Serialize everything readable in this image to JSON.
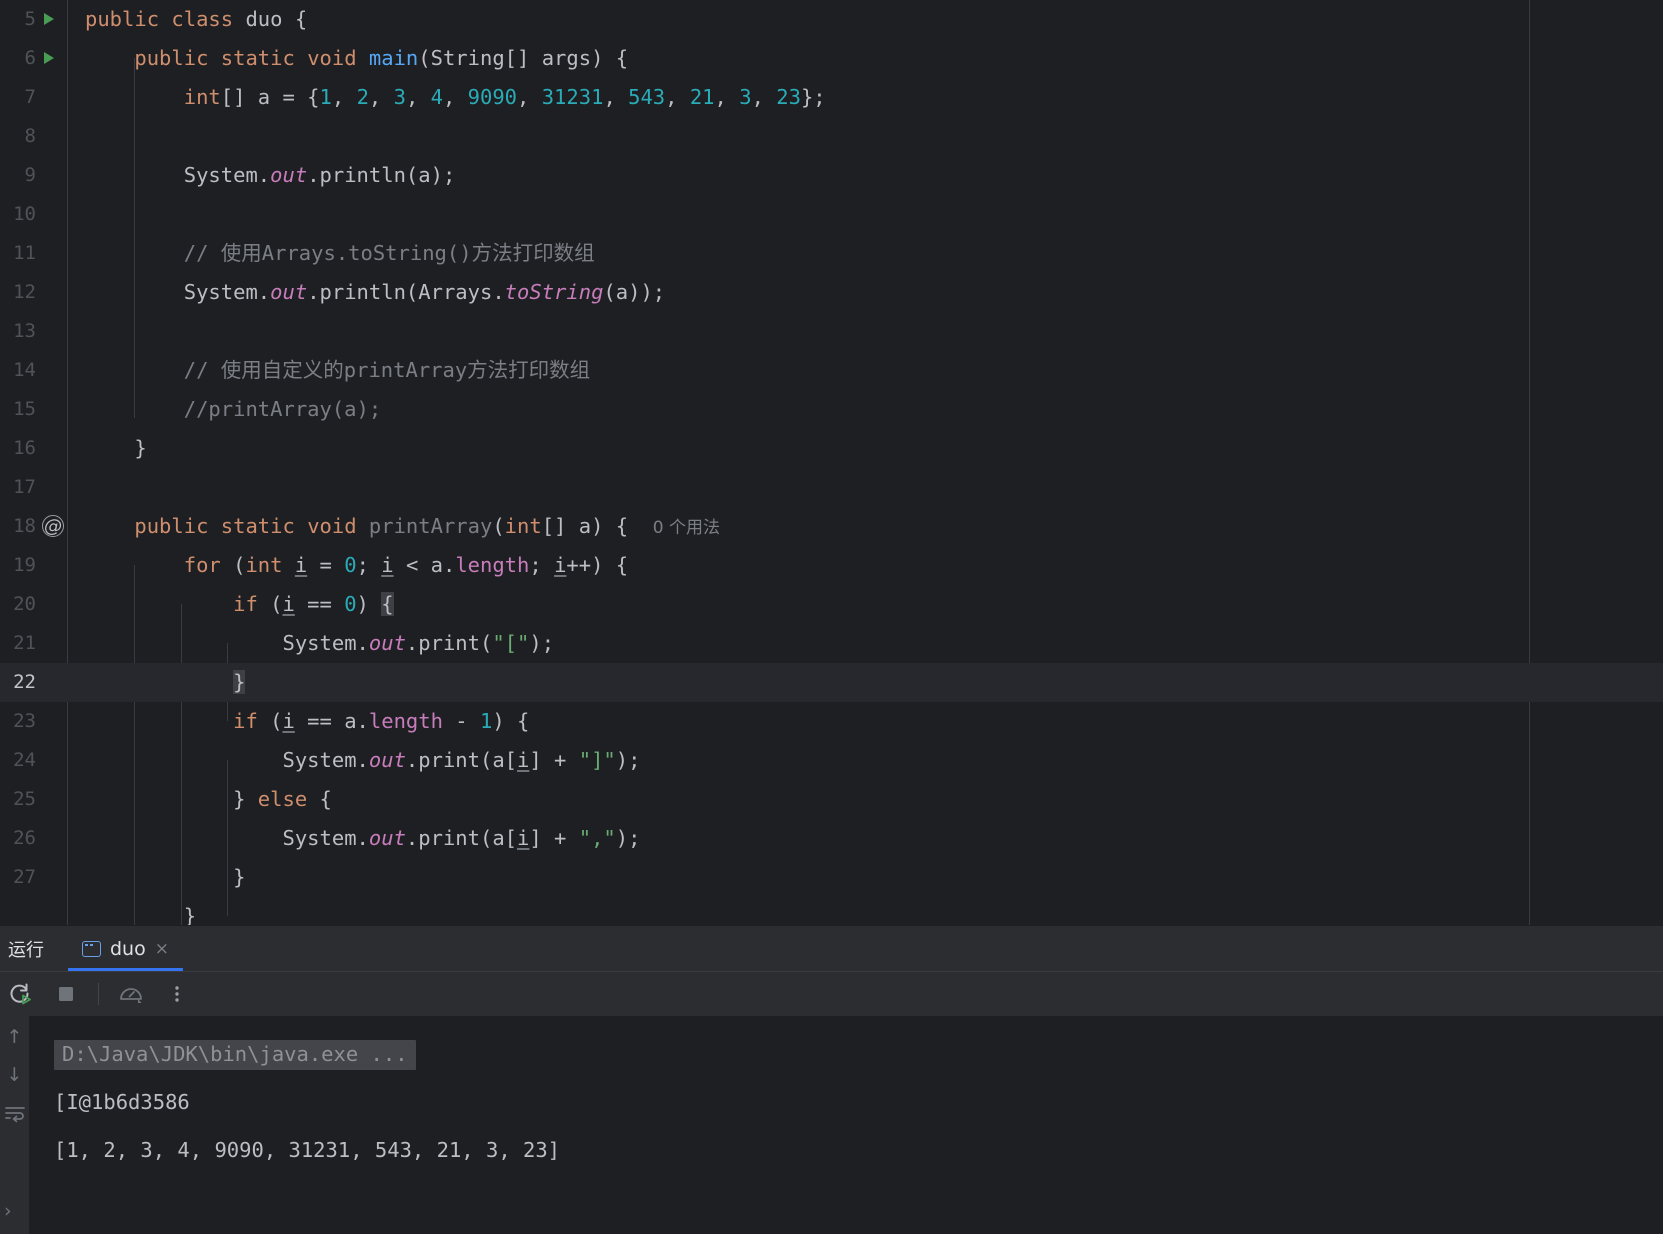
{
  "editor": {
    "first_visible_line": 5,
    "current_line": 22,
    "lines": [
      {
        "n": 5,
        "gutter": "run-arrow-icon",
        "text": "public class duo {"
      },
      {
        "n": 6,
        "gutter": "run-arrow-icon",
        "text": "    public static void main(String[] args) {"
      },
      {
        "n": 7,
        "gutter": "",
        "text": "        int[] a = {1, 2, 3, 4, 9090, 31231, 543, 21, 3, 23};"
      },
      {
        "n": 8,
        "gutter": "",
        "text": ""
      },
      {
        "n": 9,
        "gutter": "",
        "text": "        System.out.println(a);"
      },
      {
        "n": 10,
        "gutter": "",
        "text": ""
      },
      {
        "n": 11,
        "gutter": "",
        "text": "        // 使用Arrays.toString()方法打印数组"
      },
      {
        "n": 12,
        "gutter": "",
        "text": "        System.out.println(Arrays.toString(a));"
      },
      {
        "n": 13,
        "gutter": "",
        "text": ""
      },
      {
        "n": 14,
        "gutter": "",
        "text": "        // 使用自定义的printArray方法打印数组"
      },
      {
        "n": 15,
        "gutter": "",
        "text": "        //printArray(a);"
      },
      {
        "n": 16,
        "gutter": "",
        "text": "    }"
      },
      {
        "n": 17,
        "gutter": "",
        "text": ""
      },
      {
        "n": 18,
        "gutter": "annotation-icon",
        "text": "    public static void printArray(int[] a) {",
        "hint": "0 个用法"
      },
      {
        "n": 19,
        "gutter": "",
        "text": "        for (int i = 0; i < a.length; i++) {"
      },
      {
        "n": 20,
        "gutter": "",
        "text": "            if (i == 0) {"
      },
      {
        "n": 21,
        "gutter": "",
        "text": "                System.out.print(\"[\");"
      },
      {
        "n": 22,
        "gutter": "",
        "text": "            }"
      },
      {
        "n": 23,
        "gutter": "",
        "text": "            if (i == a.length - 1) {"
      },
      {
        "n": 24,
        "gutter": "",
        "text": "                System.out.print(a[i] + \"]\");"
      },
      {
        "n": 25,
        "gutter": "",
        "text": "            } else {"
      },
      {
        "n": 26,
        "gutter": "",
        "text": "                System.out.print(a[i] + \",\");"
      },
      {
        "n": 27,
        "gutter": "",
        "text": "            }"
      }
    ],
    "usage_hint_line_18": "0 个用法"
  },
  "run_panel": {
    "title": "运行",
    "tab": {
      "label": "duo",
      "icon": "console-icon",
      "close": "×",
      "active": true
    },
    "toolbar": {
      "rerun": "rerun-icon",
      "stop": "stop-icon",
      "profiler": "profiler-icon",
      "more": "more-options-icon"
    },
    "console_sidebar": {
      "up": "↑",
      "down": "↓",
      "soft_wrap": "soft-wrap-icon",
      "expand": "›"
    },
    "console": {
      "command": "D:\\Java\\JDK\\bin\\java.exe ...",
      "lines": [
        "[I@1b6d3586",
        "[1, 2, 3, 4, 9090, 31231, 543, 21, 3, 23]"
      ]
    }
  },
  "colors": {
    "editor_bg": "#1e1f22",
    "panel_bg": "#2b2d30",
    "accent": "#3574f0",
    "keyword": "#cf8e6d",
    "number": "#2aacb8",
    "string": "#6aab73",
    "comment": "#7a7e85",
    "method": "#56a8f5",
    "field": "#c77dbb",
    "text": "#bcbec4",
    "current_line": "#26282e"
  }
}
